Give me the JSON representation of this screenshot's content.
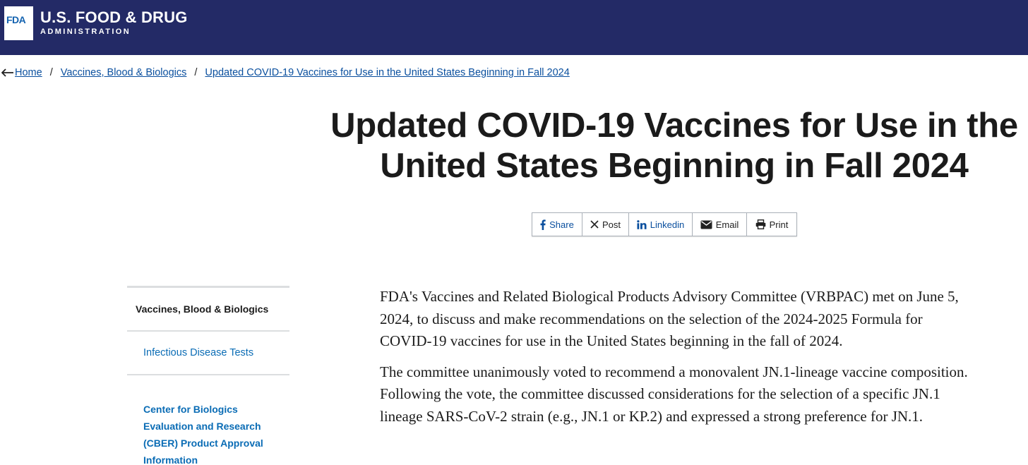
{
  "header": {
    "logo_text": "FDA",
    "title": "U.S. FOOD & DRUG",
    "subtitle": "ADMINISTRATION",
    "bg_color": "#232a66"
  },
  "breadcrumb": {
    "back_icon": "arrow-left-icon",
    "items": [
      {
        "label": "Home"
      },
      {
        "label": "Vaccines, Blood & Biologics"
      },
      {
        "label": "Updated COVID-19 Vaccines for Use in the United States Beginning in Fall 2024"
      }
    ],
    "separator": "/"
  },
  "page": {
    "title": "Updated COVID-19 Vaccines for Use in the United States Beginning in Fall 2024"
  },
  "share": {
    "buttons": [
      {
        "label": "Share",
        "icon": "facebook-icon"
      },
      {
        "label": "Post",
        "icon": "x-icon"
      },
      {
        "label": "Linkedin",
        "icon": "linkedin-icon"
      },
      {
        "label": "Email",
        "icon": "envelope-icon"
      },
      {
        "label": "Print",
        "icon": "printer-icon"
      }
    ]
  },
  "sidebar": {
    "heading": "Vaccines, Blood & Biologics",
    "items": [
      {
        "label": "Infectious Disease Tests"
      },
      {
        "label": "Center for Biologics Evaluation and Research (CBER) Product Approval Information"
      }
    ]
  },
  "content": {
    "paragraphs": [
      "FDA's Vaccines and Related Biological Products Advisory Committee (VRBPAC) met on June 5, 2024, to discuss and make recommendations on the selection of the 2024-2025 Formula for COVID-19 vaccines for use in the United States beginning in the fall of 2024.",
      "The committee unanimously voted to recommend a monovalent JN.1-lineage vaccine composition. Following the vote, the committee discussed considerations for the selection of a specific JN.1 lineage SARS-CoV-2 strain (e.g., JN.1 or KP.2) and expressed a strong preference for JN.1."
    ]
  },
  "colors": {
    "link": "#0a4f9e",
    "sidebar_link": "#0a6cb5",
    "text": "#1b1b1b"
  }
}
